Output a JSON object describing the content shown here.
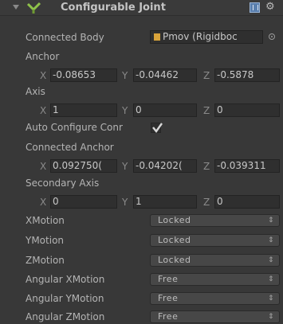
{
  "component": {
    "title": "Configurable Joint",
    "connected_body_label": "Connected Body",
    "connected_body_value": "Pmov (Rigidboc"
  },
  "anchor": {
    "label": "Anchor",
    "x": "-0.08653",
    "y": "-0.04462",
    "z": "-0.5878"
  },
  "axis": {
    "label": "Axis",
    "x": "1",
    "y": "0",
    "z": "0"
  },
  "auto_configure": {
    "label": "Auto Configure Conr",
    "checked": true
  },
  "connected_anchor": {
    "label": "Connected Anchor",
    "x": "0.092750(",
    "y": "-0.04202(",
    "z": "-0.039311"
  },
  "secondary_axis": {
    "label": "Secondary Axis",
    "x": "0",
    "y": "1",
    "z": "0"
  },
  "axis_letters": {
    "x": "X",
    "y": "Y",
    "z": "Z"
  },
  "motions": [
    {
      "label": "XMotion",
      "value": "Locked"
    },
    {
      "label": "YMotion",
      "value": "Locked"
    },
    {
      "label": "ZMotion",
      "value": "Locked"
    },
    {
      "label": "Angular XMotion",
      "value": "Free"
    },
    {
      "label": "Angular YMotion",
      "value": "Free"
    },
    {
      "label": "Angular ZMotion",
      "value": "Free"
    }
  ],
  "icons": {
    "fold": "fold-triangle-icon",
    "joint": "joint-icon",
    "help": "help-book-icon",
    "settings": "gear-icon",
    "rigidbody": "rigidbody-icon",
    "object_picker": "object-picker-icon",
    "checkmark": "checkmark-icon",
    "popup_arrow": "dropdown-arrow-icon"
  }
}
